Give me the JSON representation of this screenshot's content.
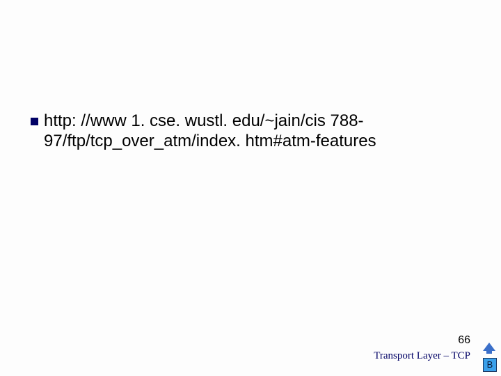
{
  "body": {
    "bullet_text": "http: //www 1. cse. wustl. edu/~jain/cis 788-97/ftp/tcp_over_atm/index. htm#atm-features"
  },
  "footer": {
    "page_number": "66",
    "label": "Transport Layer – TCP"
  },
  "nav": {
    "b_label": "B"
  }
}
